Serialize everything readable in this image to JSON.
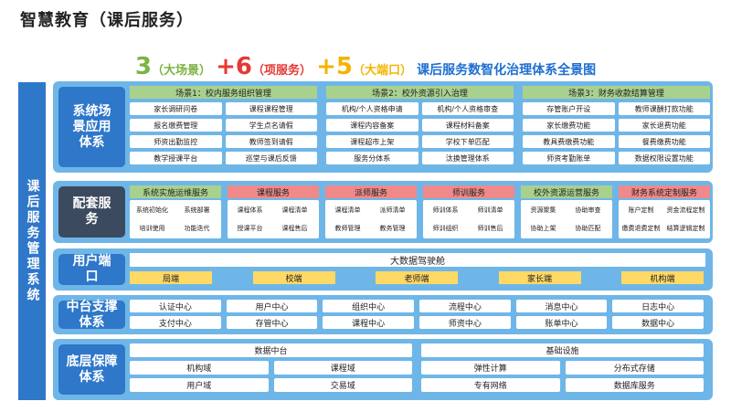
{
  "page_title": "智慧教育（课后服务）",
  "headline": {
    "n1": "3",
    "t1": "（大场景）",
    "n2": "+6",
    "t2": "（项服务）",
    "n3": "+5",
    "t3": "（大端口）",
    "tail": "课后服务数智化治理体系全景图"
  },
  "colors": {
    "green": "#7cb342",
    "red": "#e53935",
    "yellow": "#f4b400",
    "blue": "#1e6fd0",
    "layer_bg": "#6fb6e8",
    "label_bg": "#2f77c9"
  },
  "side_label": "课后服务管理系统",
  "scene": {
    "label": "系统场景应用体系",
    "groups": [
      {
        "title": "场景1：校内服务组织管理",
        "items": [
          "家长调研问卷",
          "课程课程管理",
          "报名缴费管理",
          "学生点名请假",
          "师资出勤监控",
          "教师签到请假",
          "教学授课平台",
          "巡堂与课后反馈"
        ]
      },
      {
        "title": "场景2：校外资源引入治理",
        "items": [
          "机构/个人资格申请",
          "机构/个人资格审查",
          "课程内容备案",
          "课程材料备案",
          "课程超市上架",
          "学校下单匹配",
          "服务分体系",
          "汰换管理体系"
        ]
      },
      {
        "title": "场景3：财务收款结算管理",
        "items": [
          "存管账户开设",
          "教师课酬打款功能",
          "家长缴费功能",
          "家长退费功能",
          "教具费缴费功能",
          "餐费缴费功能",
          "师资考勤账单",
          "数据权限设置功能"
        ]
      }
    ]
  },
  "services": {
    "label": "配套服务",
    "groups": [
      {
        "title": "系统实施运维服务",
        "color": "green",
        "items": [
          "系统初始化",
          "系统部署",
          "培训使用",
          "功能迭代"
        ]
      },
      {
        "title": "课程服务",
        "color": "pink",
        "items": [
          "课程体系",
          "课程清单",
          "授课平台",
          "课程售后"
        ]
      },
      {
        "title": "派师服务",
        "color": "pink",
        "items": [
          "课程清单",
          "派师清单",
          "教师管理",
          "教务管理"
        ]
      },
      {
        "title": "师训服务",
        "color": "pink",
        "items": [
          "师训体系",
          "师训清单",
          "师训组织",
          "师训售后"
        ]
      },
      {
        "title": "校外资源运营服务",
        "color": "green",
        "items": [
          "资源聚集",
          "协助审查",
          "协助上架",
          "协助匹配"
        ]
      },
      {
        "title": "财务系统定制服务",
        "color": "pink",
        "items": [
          "账户定制",
          "资金流程定制",
          "缴费退费定制",
          "结算逻辑定制"
        ]
      }
    ]
  },
  "ports": {
    "label": "用户端口",
    "cockpit": "大数据驾驶舱",
    "items": [
      "局端",
      "校端",
      "老师端",
      "家长端",
      "机构端"
    ]
  },
  "middle": {
    "label": "中台支撑体系",
    "items": [
      "认证中心",
      "用户中心",
      "组织中心",
      "流程中心",
      "消息中心",
      "日志中心",
      "支付中心",
      "存管中心",
      "课程中心",
      "师资中心",
      "账单中心",
      "数据中心"
    ]
  },
  "base": {
    "label": "底层保障体系",
    "left_title": "数据中台",
    "left_items": [
      "机构域",
      "课程域",
      "用户域",
      "交易域"
    ],
    "right_title": "基础设施",
    "right_items": [
      "弹性计算",
      "分布式存储",
      "专有网络",
      "数据库服务"
    ]
  }
}
